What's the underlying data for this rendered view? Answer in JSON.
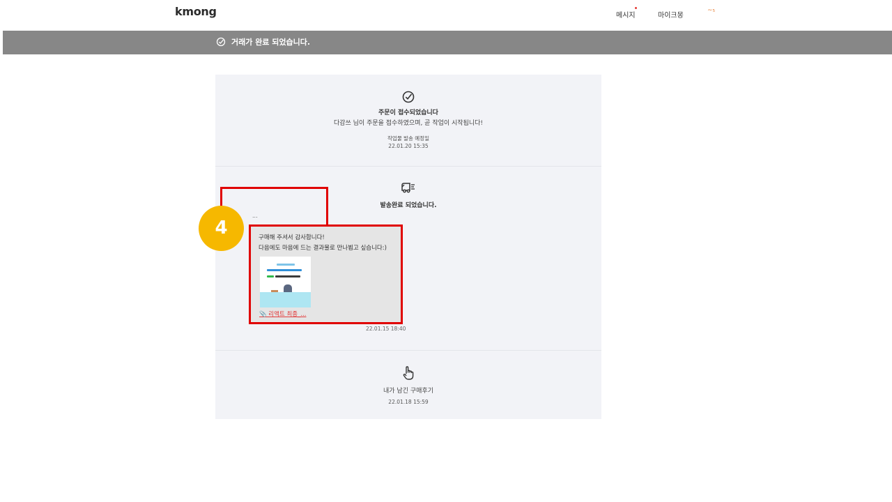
{
  "header": {
    "logo": "kmong",
    "nav_messages": "메시지",
    "nav_mykmong": "마이크몽",
    "nav_profile": "∼₅"
  },
  "banner": {
    "text": "거래가 완료 되었습니다."
  },
  "timeline": {
    "order": {
      "title": "주문이 접수되었습니다",
      "description": "다감쓰 님이 주문을 접수하였으며, 곧 작업이 시작됩니다!",
      "due_label": "작업물 발송 예정일",
      "due_date": "22.01.20 15:35"
    },
    "delivery": {
      "title": "발송완료 되었습니다.",
      "sender_preview": "...",
      "message_line1": "구매해 주셔서 감사합니다!",
      "message_line2": "다음에도 마음에 드는 결과물로 만나뵙고 싶습니다:)",
      "attachment_link": "📎 리액트 최종_...",
      "timestamp": "22.01.15 18:40"
    },
    "review": {
      "title": "내가 남긴 구매후기",
      "date": "22.01.18 15:59"
    }
  },
  "annotation": {
    "step_number": "4"
  },
  "colors": {
    "banner_bg": "#878787",
    "card_bg": "#f2f3f7",
    "highlight_red": "#e00000",
    "badge_yellow": "#f6b800",
    "link_red": "#e23a3a"
  }
}
